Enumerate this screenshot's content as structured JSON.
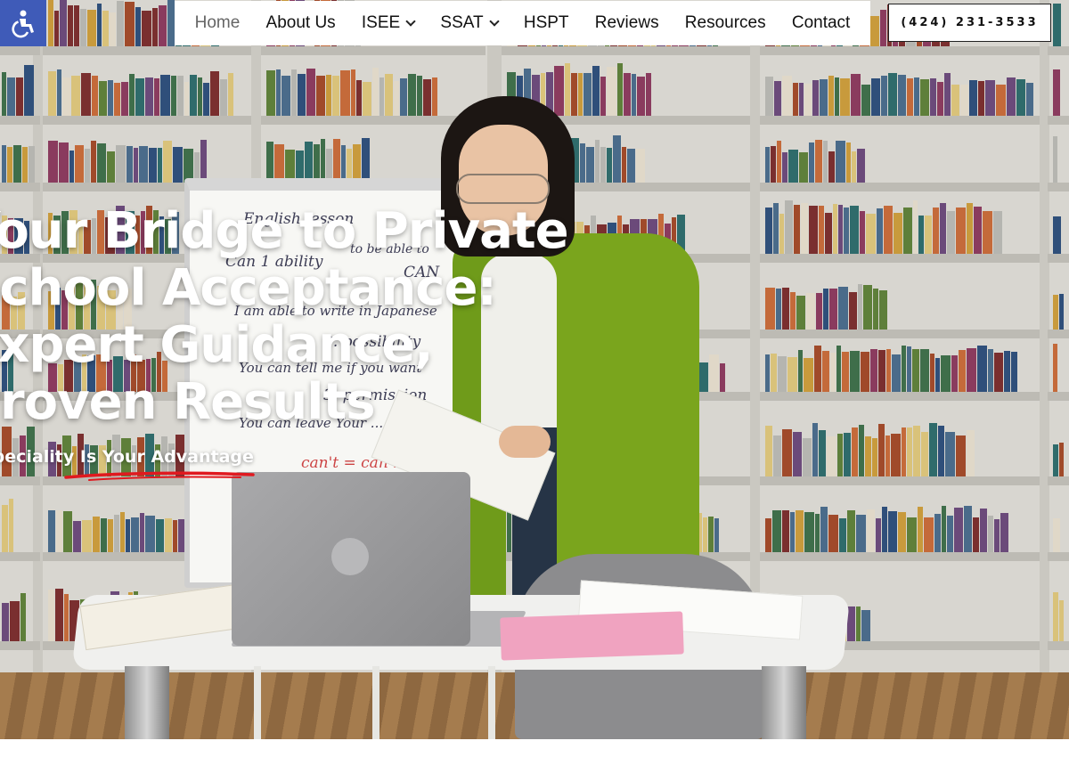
{
  "nav": {
    "items": [
      {
        "label": "Home",
        "active": true,
        "dropdown": false
      },
      {
        "label": "About Us",
        "active": false,
        "dropdown": false
      },
      {
        "label": "ISEE",
        "active": false,
        "dropdown": true
      },
      {
        "label": "SSAT",
        "active": false,
        "dropdown": true
      },
      {
        "label": "HSPT",
        "active": false,
        "dropdown": false
      },
      {
        "label": "Reviews",
        "active": false,
        "dropdown": false
      },
      {
        "label": "Resources",
        "active": false,
        "dropdown": false
      },
      {
        "label": "Contact",
        "active": false,
        "dropdown": false
      }
    ],
    "phone": "(424) 231-3533"
  },
  "accessibility": {
    "icon": "accessibility-icon",
    "color": "#3f5bb8"
  },
  "hero": {
    "headline_lines": [
      "Your Bridge to Private",
      "School Acceptance:",
      "Expert Guidance,",
      "Proven Results"
    ],
    "tagline": "Speciality Is Your Advantage",
    "underline_color": "#e0191f"
  },
  "whiteboard": {
    "lines": [
      "English lesson",
      "Can  1 ability",
      "to be able to",
      "CAN",
      "I am able to write in Japanese",
      "2. possibility",
      "You can tell me if you want",
      "3. permission",
      "You can leave  Your ...",
      "can't = can not"
    ]
  }
}
